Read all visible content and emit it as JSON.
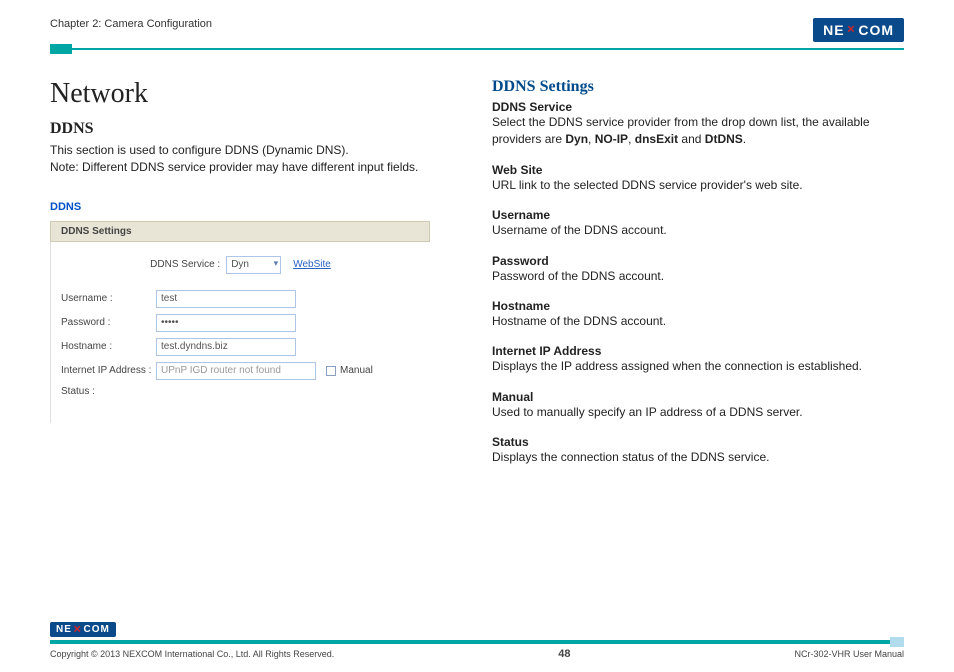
{
  "header": {
    "chapter": "Chapter 2: Camera Configuration",
    "logo_pre": "NE",
    "logo_x": "X",
    "logo_post": "COM"
  },
  "left": {
    "title": "Network",
    "subtitle": "DDNS",
    "intro1": "This section is used to configure DDNS (Dynamic DNS).",
    "intro2": "Note: Different DDNS service provider may have different input fields."
  },
  "shot": {
    "title": "DDNS",
    "bar": "DDNS Settings",
    "svc_label": "DDNS Service :",
    "svc_value": "Dyn",
    "website": "WebSite",
    "user_label": "Username :",
    "user_value": "test",
    "pass_label": "Password :",
    "pass_value": "•••••",
    "host_label": "Hostname :",
    "host_value": "test.dyndns.biz",
    "ip_label": "Internet IP Address :",
    "ip_value": "UPnP IGD router not found",
    "manual": "Manual",
    "status_label": "Status :"
  },
  "right": {
    "heading": "DDNS Settings",
    "svc_h": "DDNS Service",
    "svc_t1": "Select the DDNS service provider from the drop down list, the available providers are ",
    "svc_b1": "Dyn",
    "svc_c1": ", ",
    "svc_b2": "NO-IP",
    "svc_c2": ", ",
    "svc_b3": "dnsExit",
    "svc_c3": " and ",
    "svc_b4": "DtDNS",
    "svc_c4": ".",
    "web_h": "Web Site",
    "web_t": "URL link to the selected DDNS service provider's web site.",
    "user_h": "Username",
    "user_t": "Username of the DDNS account.",
    "pass_h": "Password",
    "pass_t": "Password of the DDNS account.",
    "host_h": "Hostname",
    "host_t": "Hostname of the DDNS account.",
    "ip_h": "Internet IP Address",
    "ip_t": "Displays the IP address assigned when the connection is established.",
    "man_h": "Manual",
    "man_t": "Used to manually specify an IP address of a DDNS server.",
    "stat_h": "Status",
    "stat_t": "Displays the connection status of the DDNS service."
  },
  "footer": {
    "copyright": "Copyright © 2013 NEXCOM International Co., Ltd. All Rights Reserved.",
    "page": "48",
    "manual": "NCr-302-VHR User Manual"
  }
}
